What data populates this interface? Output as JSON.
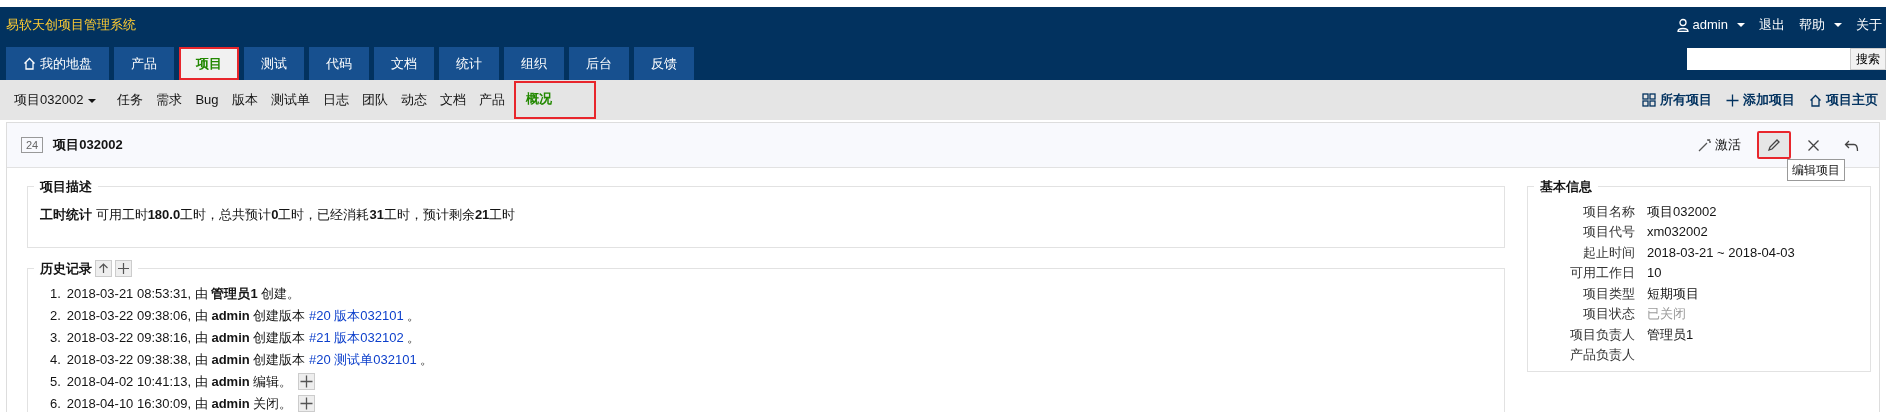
{
  "app_title": "易软天创项目管理系统",
  "user_menu": [
    {
      "kind": "user",
      "label": "admin"
    },
    {
      "kind": "link",
      "label": "退出"
    },
    {
      "kind": "dropdown",
      "label": "帮助"
    },
    {
      "kind": "link",
      "label": "关于"
    }
  ],
  "search": {
    "button": "搜索"
  },
  "main_tabs": [
    {
      "label": "我的地盘",
      "kind": "home",
      "selected": false,
      "highlighted": false
    },
    {
      "label": "产品",
      "kind": "plain",
      "selected": false,
      "highlighted": false
    },
    {
      "label": "项目",
      "kind": "plain",
      "selected": true,
      "highlighted": true
    },
    {
      "label": "测试",
      "kind": "plain",
      "selected": false,
      "highlighted": false
    },
    {
      "label": "代码",
      "kind": "plain",
      "selected": false,
      "highlighted": false
    },
    {
      "label": "文档",
      "kind": "plain",
      "selected": false,
      "highlighted": false
    },
    {
      "label": "统计",
      "kind": "plain",
      "selected": false,
      "highlighted": false
    },
    {
      "label": "组织",
      "kind": "plain",
      "selected": false,
      "highlighted": false
    },
    {
      "label": "后台",
      "kind": "plain",
      "selected": false,
      "highlighted": false
    },
    {
      "label": "反馈",
      "kind": "plain",
      "selected": false,
      "highlighted": false
    }
  ],
  "sub_nav": {
    "project_switcher": "项目032002",
    "items": [
      {
        "label": "任务",
        "selected": false,
        "highlighted": false
      },
      {
        "label": "需求",
        "selected": false,
        "highlighted": false
      },
      {
        "label": "Bug",
        "selected": false,
        "highlighted": false
      },
      {
        "label": "版本",
        "selected": false,
        "highlighted": false
      },
      {
        "label": "测试单",
        "selected": false,
        "highlighted": false
      },
      {
        "label": "日志",
        "selected": false,
        "highlighted": false
      },
      {
        "label": "团队",
        "selected": false,
        "highlighted": false
      },
      {
        "label": "动态",
        "selected": false,
        "highlighted": false
      },
      {
        "label": "文档",
        "selected": false,
        "highlighted": false
      },
      {
        "label": "产品",
        "selected": false,
        "highlighted": false
      },
      {
        "label": "概况",
        "selected": true,
        "highlighted": true
      }
    ],
    "actions": [
      {
        "kind": "grid",
        "label": "所有项目"
      },
      {
        "kind": "plus",
        "label": "添加项目"
      },
      {
        "kind": "home",
        "label": "项目主页"
      }
    ]
  },
  "page_header": {
    "id": "24",
    "title": "项目032002",
    "actions": [
      {
        "kind": "activate",
        "label": "激活",
        "highlighted": false,
        "hovered": false
      },
      {
        "kind": "edit",
        "highlighted": true,
        "hovered": true
      },
      {
        "kind": "close",
        "highlighted": false,
        "hovered": false
      },
      {
        "kind": "back",
        "highlighted": false,
        "hovered": false
      }
    ],
    "tooltip": "编辑项目"
  },
  "description": {
    "title": "项目描述",
    "text": "**工时统计** 可用工时**180.0**工时，总共预计**0**工时，已经消耗**31**工时，预计剩余**21**工时"
  },
  "history": {
    "title": "历史记录",
    "entries": [
      {
        "number": "1.",
        "text": "2018-03-21 08:53:31, 由 **管理员1** 创建。",
        "expandable": false
      },
      {
        "number": "2.",
        "text": "2018-03-22 09:38:06, 由 **admin** 创建版本",
        "link": "#20 版本032101",
        "suffix": "。",
        "expandable": false
      },
      {
        "number": "3.",
        "text": "2018-03-22 09:38:16, 由 **admin** 创建版本",
        "link": "#21 版本032102",
        "suffix": "。",
        "expandable": false
      },
      {
        "number": "4.",
        "text": "2018-03-22 09:38:38, 由 **admin** 创建版本",
        "link": "#20 测试单032101",
        "suffix": "。",
        "expandable": false
      },
      {
        "number": "5.",
        "text": "2018-04-02 10:41:13, 由 **admin** 编辑。",
        "expandable": true
      },
      {
        "number": "6.",
        "text": "2018-04-10 16:30:09, 由 **admin** 关闭。",
        "expandable": true
      }
    ]
  },
  "basic_info": {
    "title": "基本信息",
    "rows": [
      {
        "label": "项目名称",
        "value": "项目032002",
        "muted": false
      },
      {
        "label": "项目代号",
        "value": "xm032002",
        "muted": false
      },
      {
        "label": "起止时间",
        "value": "2018-03-21 ~ 2018-04-03",
        "muted": false
      },
      {
        "label": "可用工作日",
        "value": "10",
        "muted": false
      },
      {
        "label": "项目类型",
        "value": "短期项目",
        "muted": false
      },
      {
        "label": "项目状态",
        "value": "已关闭",
        "muted": true
      },
      {
        "label": "项目负责人",
        "value": "管理员1",
        "muted": false
      },
      {
        "label": "产品负责人"
      }
    ]
  }
}
